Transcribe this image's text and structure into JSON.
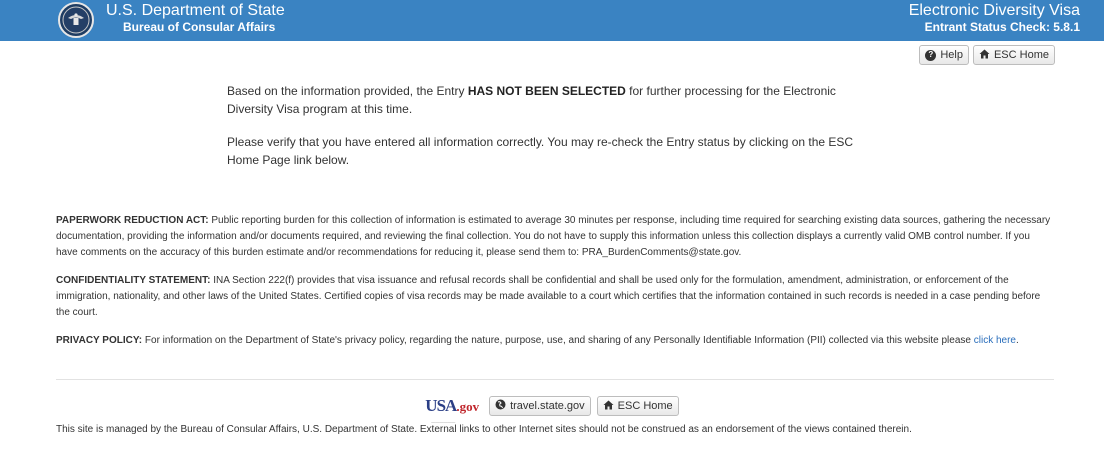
{
  "header": {
    "agency_title": "U.S. Department of State",
    "agency_subtitle": "Bureau of Consular Affairs",
    "app_title": "Electronic Diversity Visa",
    "app_subtitle": "Entrant Status Check: 5.8.1",
    "bar_color": "#3a83c2"
  },
  "toolbar": {
    "help_label": "Help",
    "help_icon": "question-circle-icon",
    "esc_home_label": "ESC Home",
    "esc_home_icon": "home-icon"
  },
  "message": {
    "p1_before": "Based on the information provided, the Entry ",
    "p1_strong": "HAS NOT BEEN SELECTED",
    "p1_after": " for further processing for the Electronic Diversity Visa program at this time.",
    "p2": "Please verify that you have entered all information correctly. You may re-check the Entry status by clicking on the ESC Home Page link below."
  },
  "legal": {
    "paperwork_title": "PAPERWORK REDUCTION ACT:",
    "paperwork_text": " Public reporting burden for this collection of information is estimated to average 30 minutes per response, including time required for searching existing data sources, gathering the necessary documentation, providing the information and/or documents required, and reviewing the final collection. You do not have to supply this information unless this collection displays a currently valid OMB control number. If you have comments on the accuracy of this burden estimate and/or recommendations for reducing it, please send them to: PRA_BurdenComments@state.gov.",
    "confidentiality_title": "CONFIDENTIALITY STATEMENT:",
    "confidentiality_text": " INA Section 222(f) provides that visa issuance and refusal records shall be confidential and shall be used only for the formulation, amendment, administration, or enforcement of the immigration, nationality, and other laws of the United States. Certified copies of visa records may be made available to a court which certifies that the information contained in such records is needed in a case pending before the court.",
    "privacy_title": "PRIVACY POLICY:",
    "privacy_text": " For information on the Department of State's privacy policy, regarding the nature, purpose, use, and sharing of any Personally Identifiable Information (PII) collected via this website please ",
    "privacy_link": "click here",
    "privacy_end": "."
  },
  "footer": {
    "usa_logo_text": "USA",
    "usa_logo_gov": ".gov",
    "travel_label": "travel.state.gov",
    "travel_icon": "globe-icon",
    "esc_home_label": "ESC Home",
    "esc_home_icon": "home-icon",
    "note": "This site is managed by the Bureau of Consular Affairs, U.S. Department of State. External links to other Internet sites should not be construed as an endorsement of the views contained therein."
  }
}
